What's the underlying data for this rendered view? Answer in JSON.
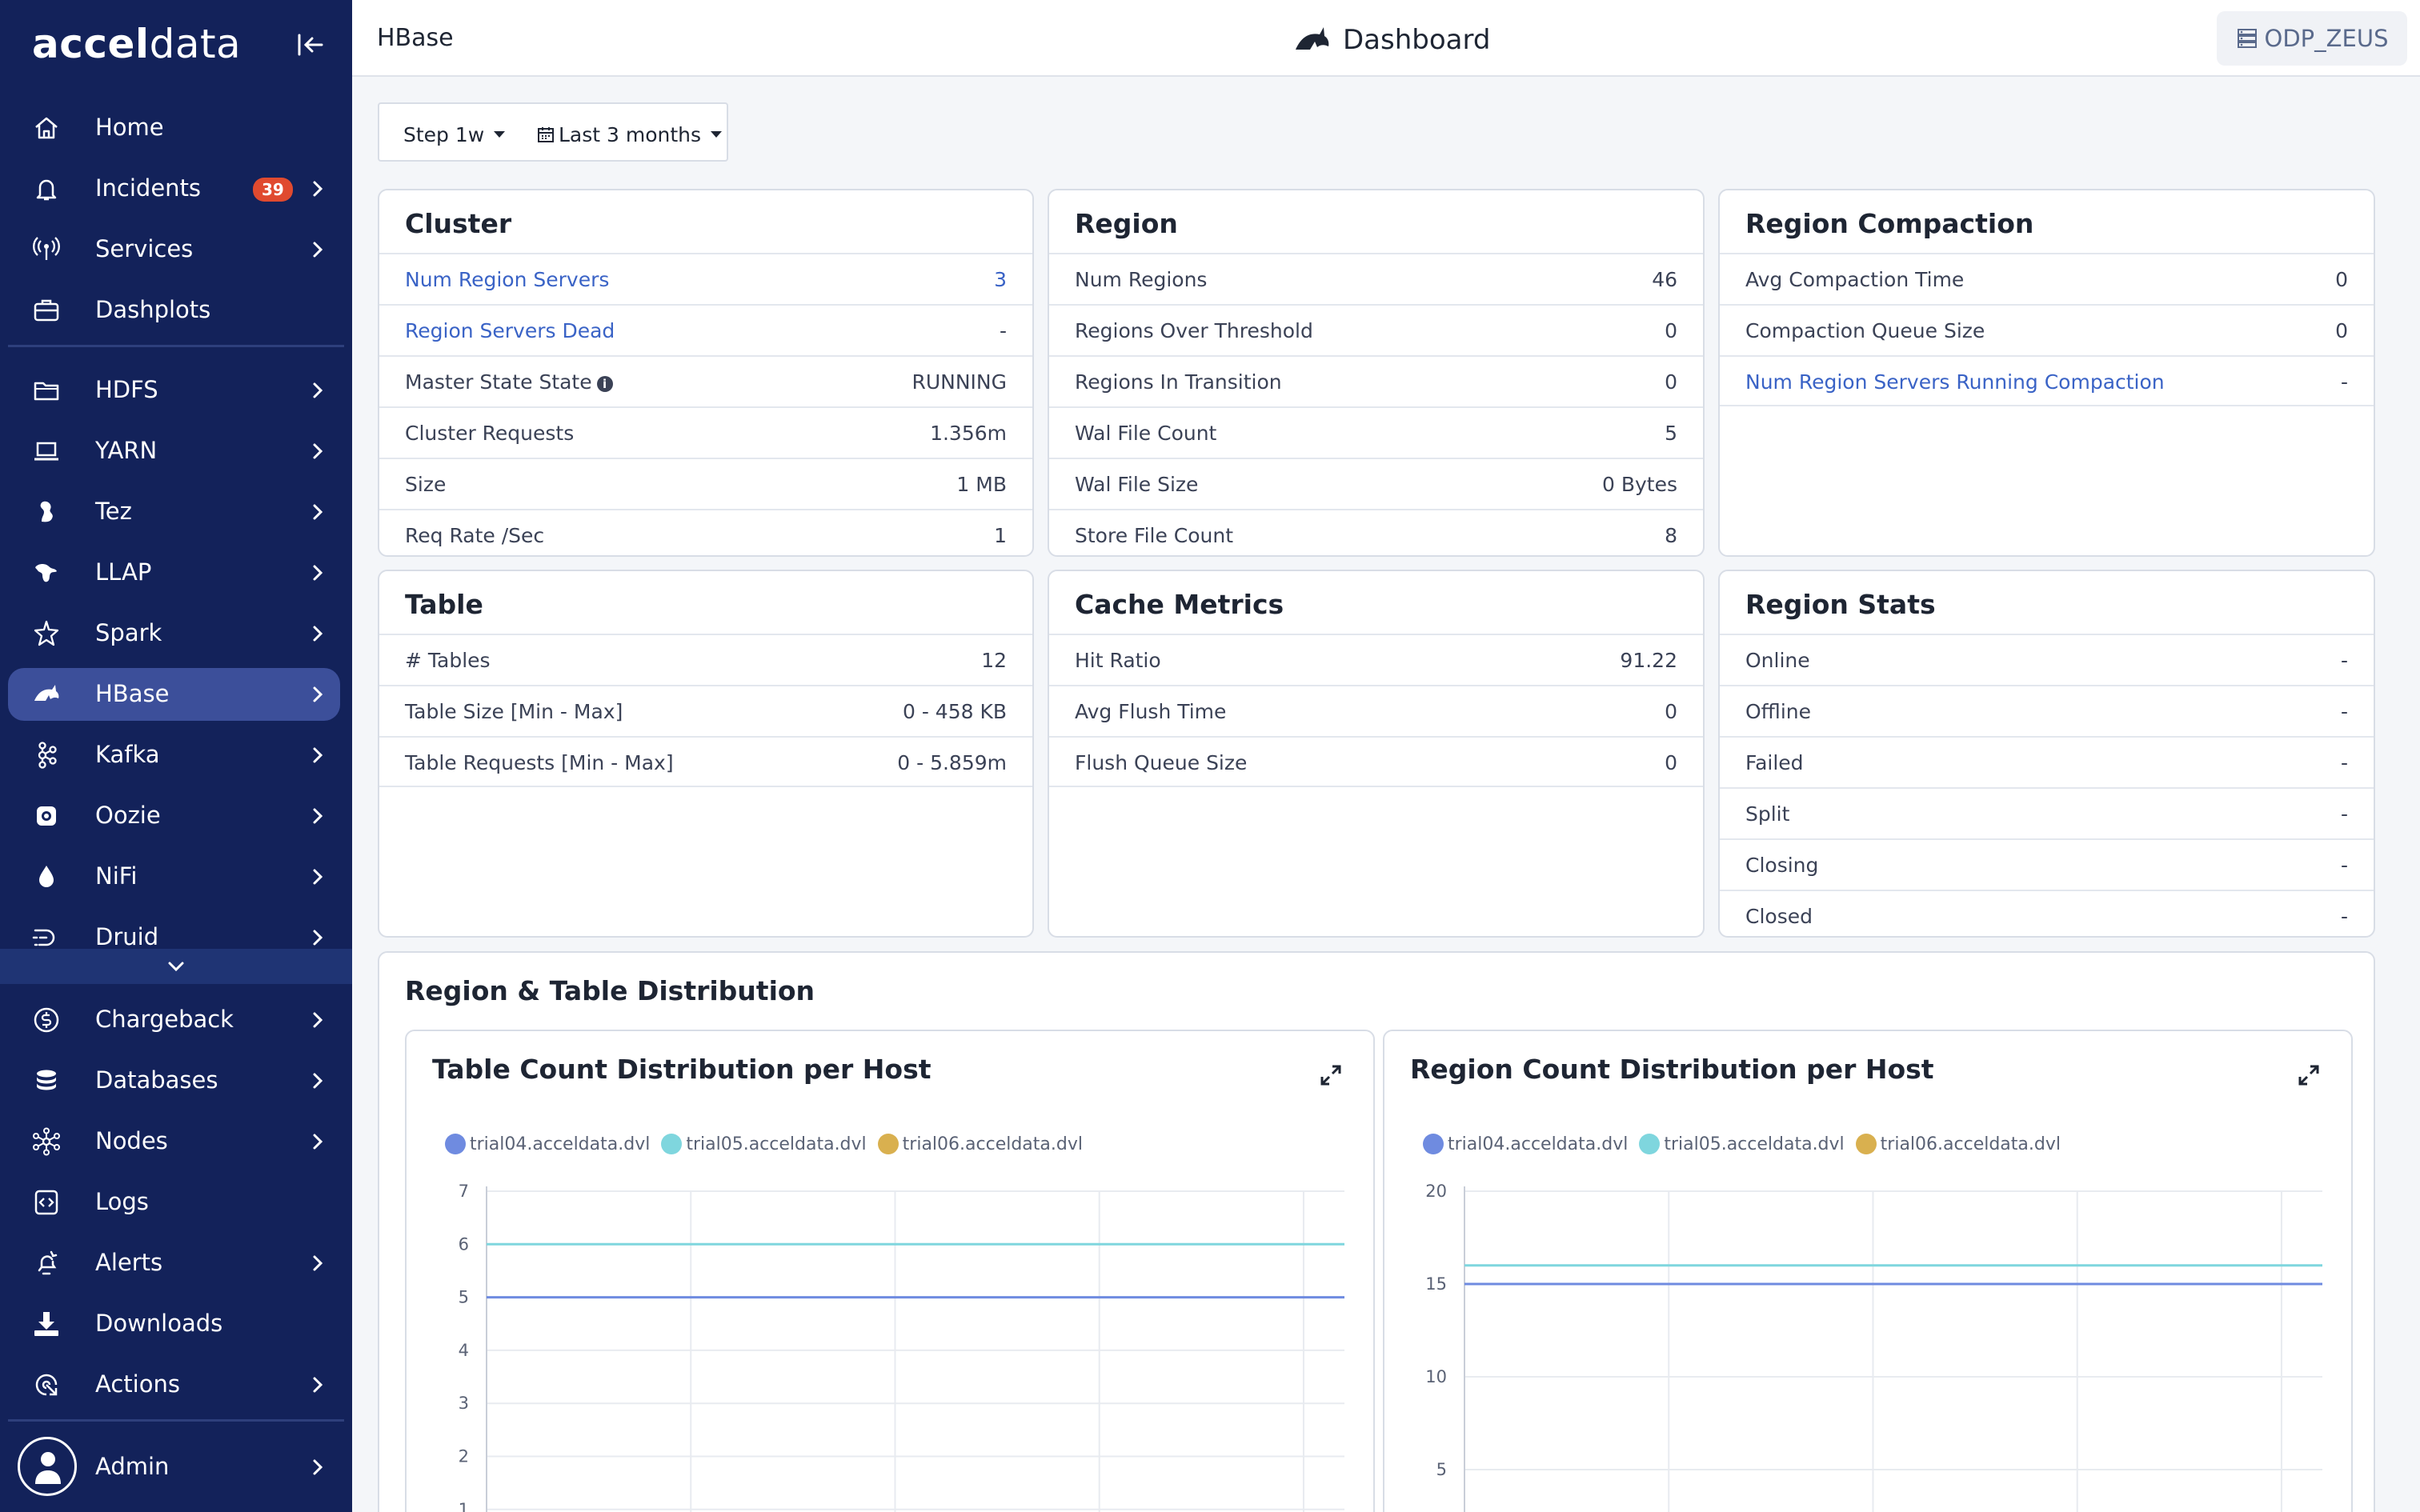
{
  "brand": {
    "name_bold": "accel",
    "name_light": "data"
  },
  "sidebar": {
    "items": [
      {
        "label": "Home",
        "icon": "home-icon"
      },
      {
        "label": "Incidents",
        "icon": "bell-icon",
        "badge": "39"
      },
      {
        "label": "Services",
        "icon": "broadcast-icon"
      },
      {
        "label": "Dashplots",
        "icon": "briefcase-icon"
      },
      {
        "label": "HDFS",
        "icon": "folder-icon"
      },
      {
        "label": "YARN",
        "icon": "laptop-icon"
      },
      {
        "label": "Tez",
        "icon": "tez-icon"
      },
      {
        "label": "LLAP",
        "icon": "llap-icon"
      },
      {
        "label": "Spark",
        "icon": "spark-icon"
      },
      {
        "label": "HBase",
        "icon": "hbase-icon"
      },
      {
        "label": "Kafka",
        "icon": "kafka-icon"
      },
      {
        "label": "Oozie",
        "icon": "oozie-icon"
      },
      {
        "label": "NiFi",
        "icon": "nifi-icon"
      },
      {
        "label": "Druid",
        "icon": "druid-icon"
      },
      {
        "label": "Chargeback",
        "icon": "dollar-icon"
      },
      {
        "label": "Databases",
        "icon": "database-icon"
      },
      {
        "label": "Nodes",
        "icon": "nodes-icon"
      },
      {
        "label": "Logs",
        "icon": "code-icon"
      },
      {
        "label": "Alerts",
        "icon": "alert-bell-icon"
      },
      {
        "label": "Downloads",
        "icon": "download-icon"
      },
      {
        "label": "Actions",
        "icon": "actions-icon"
      },
      {
        "label": "Admin",
        "icon": "user-icon"
      }
    ]
  },
  "header": {
    "breadcrumb": "HBase",
    "title": "Dashboard",
    "cluster": "ODP_ZEUS"
  },
  "toolbar": {
    "step": "Step 1w",
    "range": "Last 3 months"
  },
  "cards": {
    "cluster": {
      "title": "Cluster",
      "rows": [
        {
          "label": "Num Region Servers",
          "value": "3"
        },
        {
          "label": "Region Servers Dead",
          "value": "-"
        },
        {
          "label": "Master State State",
          "value": "RUNNING"
        },
        {
          "label": "Cluster Requests",
          "value": "1.356m"
        },
        {
          "label": "Size",
          "value": "1 MB"
        },
        {
          "label": "Req Rate /Sec",
          "value": "1"
        }
      ]
    },
    "region": {
      "title": "Region",
      "rows": [
        {
          "label": "Num Regions",
          "value": "46"
        },
        {
          "label": "Regions Over Threshold",
          "value": "0"
        },
        {
          "label": "Regions In Transition",
          "value": "0"
        },
        {
          "label": "Wal File Count",
          "value": "5"
        },
        {
          "label": "Wal File Size",
          "value": "0 Bytes"
        },
        {
          "label": "Store File Count",
          "value": "8"
        }
      ]
    },
    "compaction": {
      "title": "Region Compaction",
      "rows": [
        {
          "label": "Avg Compaction Time",
          "value": "0"
        },
        {
          "label": "Compaction Queue Size",
          "value": "0"
        },
        {
          "label": "Num Region Servers Running Compaction",
          "value": "-"
        }
      ]
    },
    "table": {
      "title": "Table",
      "rows": [
        {
          "label": "# Tables",
          "value": "12"
        },
        {
          "label": "Table Size [Min - Max]",
          "value": "0 - 458 KB"
        },
        {
          "label": "Table Requests [Min - Max]",
          "value": "0 - 5.859m"
        }
      ]
    },
    "cache": {
      "title": "Cache Metrics",
      "rows": [
        {
          "label": "Hit Ratio",
          "value": "91.22"
        },
        {
          "label": "Avg Flush Time",
          "value": "0"
        },
        {
          "label": "Flush Queue Size",
          "value": "0"
        }
      ]
    },
    "region_stats": {
      "title": "Region Stats",
      "rows": [
        {
          "label": "Online",
          "value": "-"
        },
        {
          "label": "Offline",
          "value": "-"
        },
        {
          "label": "Failed",
          "value": "-"
        },
        {
          "label": "Split",
          "value": "-"
        },
        {
          "label": "Closing",
          "value": "-"
        },
        {
          "label": "Closed",
          "value": "-"
        }
      ]
    }
  },
  "distribution": {
    "title": "Region & Table Distribution"
  },
  "colors": {
    "sidebar_bg": "#13225a",
    "sidebar_active": "#3c4f9a",
    "link": "#3a63c6",
    "badge": "#e04a2f"
  },
  "chart_data": [
    {
      "type": "line",
      "title": "Table Count Distribution per Host",
      "ylim": [
        1,
        7
      ],
      "yticks": [
        "1",
        "2",
        "3",
        "4",
        "5",
        "6",
        "7"
      ],
      "grid": true,
      "legend_position": "top-left",
      "series": [
        {
          "name": "trial04.acceldata.dvl",
          "color": "#6f8be0",
          "values": [
            5,
            5,
            5,
            5,
            5
          ]
        },
        {
          "name": "trial05.acceldata.dvl",
          "color": "#7fd6de",
          "values": [
            6,
            6,
            6,
            6,
            6
          ]
        },
        {
          "name": "trial06.acceldata.dvl",
          "color": "#d9b04f",
          "values": []
        }
      ]
    },
    {
      "type": "line",
      "title": "Region Count Distribution per Host",
      "ylim": [
        5,
        20
      ],
      "yticks": [
        "5",
        "10",
        "15",
        "20"
      ],
      "grid": true,
      "legend_position": "top-left",
      "series": [
        {
          "name": "trial04.acceldata.dvl",
          "color": "#6f8be0",
          "values": [
            15,
            15,
            15,
            15,
            15
          ]
        },
        {
          "name": "trial05.acceldata.dvl",
          "color": "#7fd6de",
          "values": [
            16,
            16,
            16,
            16,
            16
          ]
        },
        {
          "name": "trial06.acceldata.dvl",
          "color": "#d9b04f",
          "values": []
        }
      ]
    }
  ]
}
